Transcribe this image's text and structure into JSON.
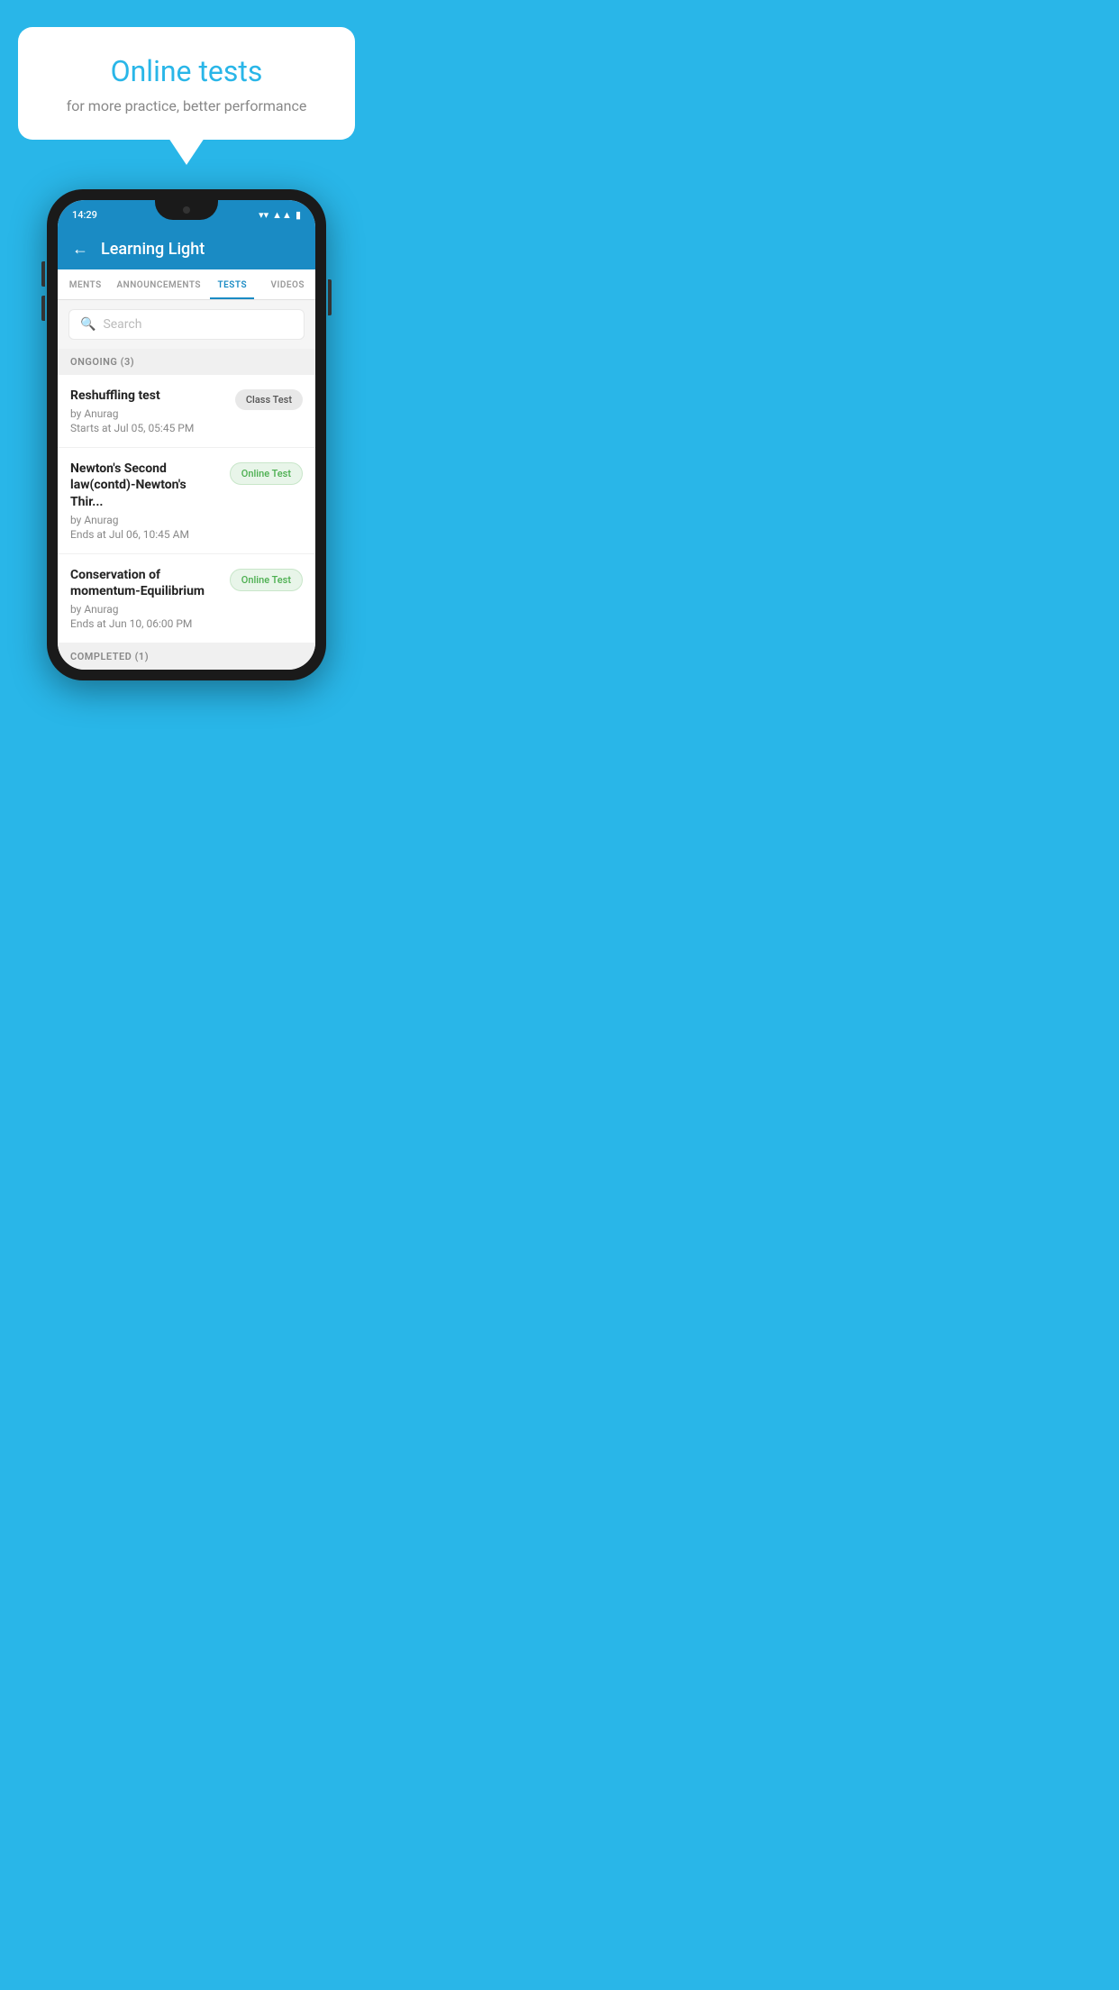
{
  "background_color": "#29b6e8",
  "bubble": {
    "title": "Online tests",
    "subtitle": "for more practice, better performance"
  },
  "phone": {
    "status_bar": {
      "time": "14:29",
      "icons": [
        "wifi",
        "signal",
        "battery"
      ]
    },
    "app_header": {
      "back_label": "←",
      "title": "Learning Light"
    },
    "tabs": [
      {
        "label": "MENTS",
        "active": false
      },
      {
        "label": "ANNOUNCEMENTS",
        "active": false
      },
      {
        "label": "TESTS",
        "active": true
      },
      {
        "label": "VIDEOS",
        "active": false
      }
    ],
    "search": {
      "placeholder": "Search"
    },
    "sections": [
      {
        "header": "ONGOING (3)",
        "items": [
          {
            "name": "Reshuffling test",
            "author": "by Anurag",
            "date_label": "Starts at",
            "date": "Jul 05, 05:45 PM",
            "badge": "Class Test",
            "badge_type": "class"
          },
          {
            "name": "Newton's Second law(contd)-Newton's Thir...",
            "author": "by Anurag",
            "date_label": "Ends at",
            "date": "Jul 06, 10:45 AM",
            "badge": "Online Test",
            "badge_type": "online"
          },
          {
            "name": "Conservation of momentum-Equilibrium",
            "author": "by Anurag",
            "date_label": "Ends at",
            "date": "Jun 10, 06:00 PM",
            "badge": "Online Test",
            "badge_type": "online"
          }
        ]
      },
      {
        "header": "COMPLETED (1)",
        "items": []
      }
    ]
  }
}
